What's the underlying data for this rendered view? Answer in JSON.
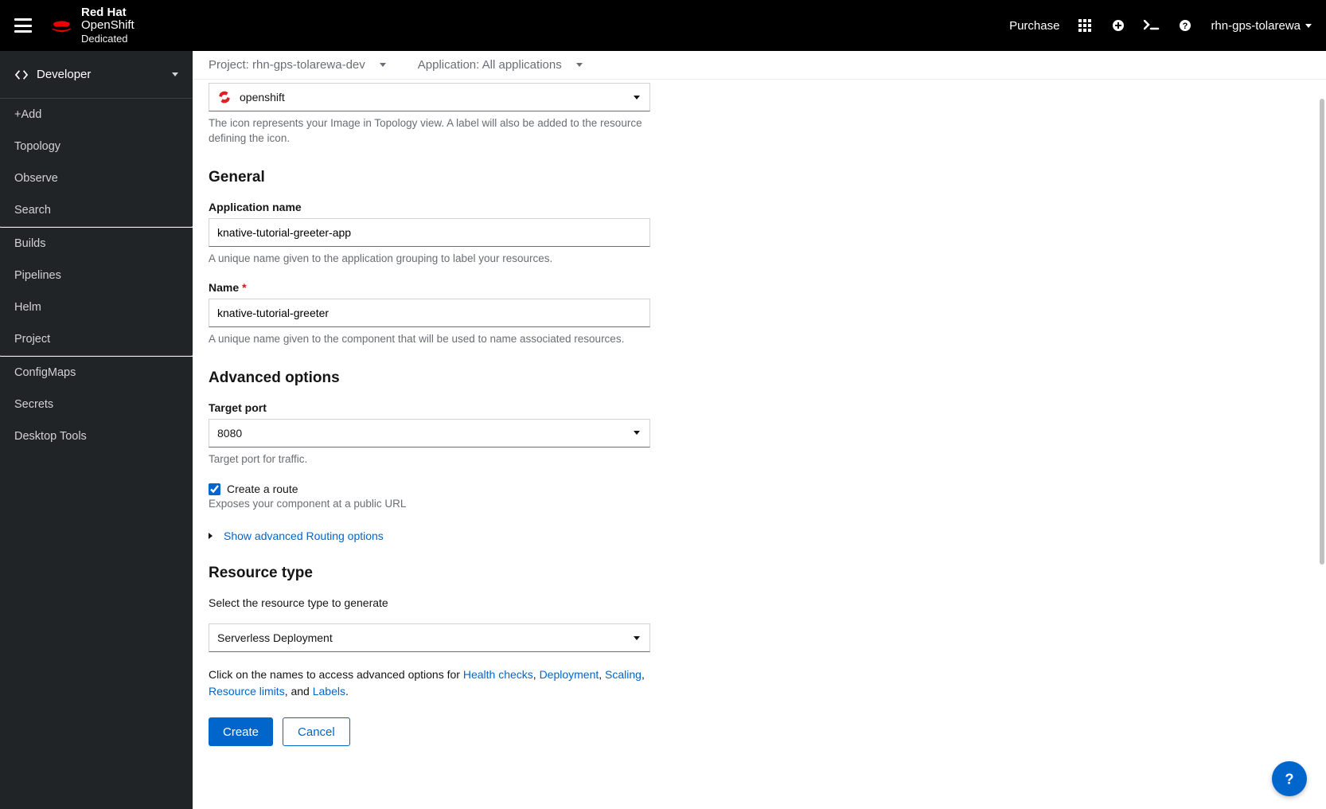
{
  "header": {
    "brand_rh": "Red Hat",
    "brand_os": "OpenShift",
    "brand_ded": "Dedicated",
    "purchase": "Purchase",
    "username": "rhn-gps-tolarewa"
  },
  "perspective": {
    "label": "Developer"
  },
  "sidebar": {
    "items1": [
      "+Add",
      "Topology",
      "Observe",
      "Search"
    ],
    "items2": [
      "Builds",
      "Pipelines",
      "Helm",
      "Project"
    ],
    "items3": [
      "ConfigMaps",
      "Secrets",
      "Desktop Tools"
    ]
  },
  "context": {
    "project": "Project: rhn-gps-tolarewa-dev",
    "application": "Application: All applications"
  },
  "icon_select": {
    "value": "openshift",
    "help": "The icon represents your Image in Topology view. A label will also be added to the resource defining the icon."
  },
  "general": {
    "heading": "General",
    "app_name_label": "Application name",
    "app_name_value": "knative-tutorial-greeter-app",
    "app_name_help": "A unique name given to the application grouping to label your resources.",
    "name_label": "Name",
    "name_value": "knative-tutorial-greeter",
    "name_help": "A unique name given to the component that will be used to name associated resources."
  },
  "advanced": {
    "heading": "Advanced options",
    "port_label": "Target port",
    "port_value": "8080",
    "port_help": "Target port for traffic.",
    "route_label": "Create a route",
    "route_help": "Exposes your component at a public URL",
    "routing_toggle": "Show advanced Routing options"
  },
  "resource": {
    "heading": "Resource type",
    "intro": "Select the resource type to generate",
    "value": "Serverless Deployment",
    "links_pre": "Click on the names to access advanced options for ",
    "link_health": "Health checks",
    "link_deploy": "Deployment",
    "link_scaling": "Scaling",
    "link_limits": "Resource limits",
    "and": ", and ",
    "link_labels": "Labels"
  },
  "buttons": {
    "create": "Create",
    "cancel": "Cancel"
  }
}
